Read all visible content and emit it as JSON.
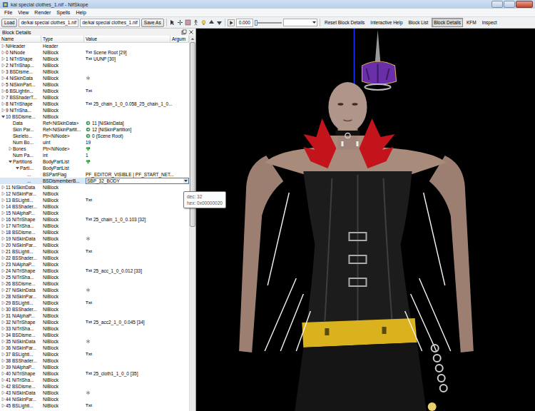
{
  "window": {
    "title": "kai special clothes_1.nif - NifSkope"
  },
  "menu": [
    "File",
    "View",
    "Render",
    "Spells",
    "Help"
  ],
  "toolbar": {
    "load": "Load",
    "paths": [
      "de/kai special clothes_1.nif",
      "de/kai special clothes_1.nif"
    ],
    "save_as": "Save As",
    "time": "0.000",
    "timeline_level": 0,
    "view_buttons": [
      {
        "label": "Reset Block Details",
        "selected": false
      },
      {
        "label": "Interactive Help",
        "selected": false
      },
      {
        "label": "Block List",
        "selected": false
      },
      {
        "label": "Block Details",
        "selected": true
      },
      {
        "label": "KFM",
        "selected": false
      },
      {
        "label": "Inspect",
        "selected": false
      }
    ]
  },
  "panel": {
    "title": "Block Details",
    "columns": [
      "Name",
      "Type",
      "Value",
      "Argum"
    ],
    "scrollbar_level": 0.5
  },
  "rows": [
    {
      "name": "NiHeader",
      "type": "Header",
      "tag": "",
      "value": "",
      "icon": "none",
      "depth": 0,
      "expandable": true,
      "expanded": false,
      "selected": false,
      "kind": "row"
    },
    {
      "name": "0 NiNode",
      "type": "NiBlock",
      "tag": "Txt",
      "value": "Scene Root [29]",
      "icon": "none",
      "depth": 0,
      "expandable": true,
      "expanded": false,
      "selected": false,
      "kind": "row"
    },
    {
      "name": "1 NiTriShape",
      "type": "NiBlock",
      "tag": "Txt",
      "value": "UUNP [30]",
      "icon": "none",
      "depth": 0,
      "expandable": true,
      "expanded": false,
      "selected": false,
      "kind": "row"
    },
    {
      "name": "2 NiTriShap...",
      "type": "NiBlock",
      "tag": "",
      "value": "",
      "icon": "none",
      "depth": 0,
      "expandable": true,
      "expanded": false,
      "selected": false,
      "kind": "row"
    },
    {
      "name": "3 BSDisme...",
      "type": "NiBlock",
      "tag": "",
      "value": "",
      "icon": "none",
      "depth": 0,
      "expandable": true,
      "expanded": false,
      "selected": false,
      "kind": "row"
    },
    {
      "name": "4 NiSkinData",
      "type": "NiBlock",
      "tag": "",
      "value": "",
      "icon": "skin",
      "depth": 0,
      "expandable": true,
      "expanded": false,
      "selected": false,
      "kind": "row"
    },
    {
      "name": "5 NiSkinPart...",
      "type": "NiBlock",
      "tag": "",
      "value": "",
      "icon": "none",
      "depth": 0,
      "expandable": true,
      "expanded": false,
      "selected": false,
      "kind": "row"
    },
    {
      "name": "6 BSLightin...",
      "type": "NiBlock",
      "tag": "Txt",
      "value": "",
      "icon": "none",
      "depth": 0,
      "expandable": true,
      "expanded": false,
      "selected": false,
      "kind": "row"
    },
    {
      "name": "7 BSShaderT...",
      "type": "NiBlock",
      "tag": "",
      "value": "",
      "icon": "none",
      "depth": 0,
      "expandable": true,
      "expanded": false,
      "selected": false,
      "kind": "row"
    },
    {
      "name": "8 NiTriShape",
      "type": "NiBlock",
      "tag": "Txt",
      "value": "25_chain_1_0_0.058_25_chain_1_0...",
      "icon": "none",
      "depth": 0,
      "expandable": true,
      "expanded": false,
      "selected": false,
      "kind": "row"
    },
    {
      "name": "9 NiTriSha...",
      "type": "NiBlock",
      "tag": "",
      "value": "",
      "icon": "none",
      "depth": 0,
      "expandable": true,
      "expanded": false,
      "selected": false,
      "kind": "row"
    },
    {
      "name": "10 BSDisme...",
      "type": "NiBlock",
      "tag": "",
      "value": "",
      "icon": "none",
      "depth": 0,
      "expandable": true,
      "expanded": true,
      "selected": false,
      "kind": "row"
    },
    {
      "name": "Data",
      "type": "Ref<NiSkinData>",
      "tag": "",
      "value": "11 [NiSkinData]",
      "icon": "ref",
      "depth": 1,
      "expandable": false,
      "expanded": false,
      "selected": false,
      "kind": "row"
    },
    {
      "name": "Skin Par...",
      "type": "Ref<NiSkinPartit...",
      "tag": "",
      "value": "12 [NiSkinPartition]",
      "icon": "ref",
      "depth": 1,
      "expandable": false,
      "expanded": false,
      "selected": false,
      "kind": "row"
    },
    {
      "name": "Skeleto...",
      "type": "Ptr<NiNode>",
      "tag": "",
      "value": "0 (Scene Root)",
      "icon": "ref",
      "depth": 1,
      "expandable": false,
      "expanded": false,
      "selected": false,
      "kind": "row"
    },
    {
      "name": "Num Bo...",
      "type": "uint",
      "tag": "",
      "value": "19",
      "icon": "none",
      "depth": 1,
      "expandable": false,
      "expanded": false,
      "selected": false,
      "kind": "row"
    },
    {
      "name": "Bones",
      "type": "Ptr<NiNode>",
      "tag": "",
      "value": "",
      "icon": "list",
      "depth": 1,
      "expandable": true,
      "expanded": false,
      "selected": false,
      "kind": "row"
    },
    {
      "name": "Num Pa...",
      "type": "int",
      "tag": "",
      "value": "1",
      "icon": "none",
      "depth": 1,
      "expandable": false,
      "expanded": false,
      "selected": false,
      "kind": "row"
    },
    {
      "name": "Partitions",
      "type": "BodyPartList",
      "tag": "",
      "value": "",
      "icon": "list",
      "depth": 1,
      "expandable": true,
      "expanded": true,
      "selected": false,
      "kind": "row"
    },
    {
      "name": "Parti...",
      "type": "BodyPartList",
      "tag": "",
      "value": "",
      "icon": "none",
      "depth": 2,
      "expandable": true,
      "expanded": true,
      "selected": false,
      "kind": "row"
    },
    {
      "name": "...",
      "type": "BSPartFlag",
      "tag": "",
      "value": "PF_EDITOR_VISIBLE | PF_START_NET...",
      "icon": "none",
      "depth": 3,
      "expandable": false,
      "expanded": false,
      "selected": false,
      "kind": "row"
    },
    {
      "name": "...",
      "type": "BSDismemberB...",
      "tag": "",
      "value": "SBP_32_BODY",
      "icon": "none",
      "depth": 3,
      "expandable": false,
      "expanded": false,
      "selected": true,
      "kind": "combo"
    },
    {
      "name": "11 NiSkinData",
      "type": "NiBlock",
      "tag": "",
      "value": "",
      "icon": "none",
      "depth": 0,
      "expandable": true,
      "expanded": false,
      "selected": false,
      "kind": "row"
    },
    {
      "name": "12 NiSkinPar...",
      "type": "NiBlock",
      "tag": "",
      "value": "",
      "icon": "none",
      "depth": 0,
      "expandable": true,
      "expanded": false,
      "selected": false,
      "kind": "row"
    },
    {
      "name": "13 BSLighti...",
      "type": "NiBlock",
      "tag": "Txt",
      "value": "",
      "icon": "none",
      "depth": 0,
      "expandable": true,
      "expanded": false,
      "selected": false,
      "kind": "row"
    },
    {
      "name": "14 BSShader...",
      "type": "NiBlock",
      "tag": "",
      "value": "",
      "icon": "none",
      "depth": 0,
      "expandable": true,
      "expanded": false,
      "selected": false,
      "kind": "row"
    },
    {
      "name": "15 NiAlphaP...",
      "type": "NiBlock",
      "tag": "",
      "value": "",
      "icon": "none",
      "depth": 0,
      "expandable": true,
      "expanded": false,
      "selected": false,
      "kind": "row"
    },
    {
      "name": "16 NiTriShape",
      "type": "NiBlock",
      "tag": "Txt",
      "value": "25_chain_1_0_0.103 [32]",
      "icon": "none",
      "depth": 0,
      "expandable": true,
      "expanded": false,
      "selected": false,
      "kind": "row"
    },
    {
      "name": "17 NiTriSha...",
      "type": "NiBlock",
      "tag": "",
      "value": "",
      "icon": "none",
      "depth": 0,
      "expandable": true,
      "expanded": false,
      "selected": false,
      "kind": "row"
    },
    {
      "name": "18 BSDisme...",
      "type": "NiBlock",
      "tag": "",
      "value": "",
      "icon": "none",
      "depth": 0,
      "expandable": true,
      "expanded": false,
      "selected": false,
      "kind": "row"
    },
    {
      "name": "19 NiSkinData",
      "type": "NiBlock",
      "tag": "",
      "value": "",
      "icon": "skin",
      "depth": 0,
      "expandable": true,
      "expanded": false,
      "selected": false,
      "kind": "row"
    },
    {
      "name": "20 NiSkinPar...",
      "type": "NiBlock",
      "tag": "",
      "value": "",
      "icon": "none",
      "depth": 0,
      "expandable": true,
      "expanded": false,
      "selected": false,
      "kind": "row"
    },
    {
      "name": "21 BSLighti...",
      "type": "NiBlock",
      "tag": "Txt",
      "value": "",
      "icon": "none",
      "depth": 0,
      "expandable": true,
      "expanded": false,
      "selected": false,
      "kind": "row"
    },
    {
      "name": "22 BSShader...",
      "type": "NiBlock",
      "tag": "",
      "value": "",
      "icon": "none",
      "depth": 0,
      "expandable": true,
      "expanded": false,
      "selected": false,
      "kind": "row"
    },
    {
      "name": "23 NiAlphaP...",
      "type": "NiBlock",
      "tag": "",
      "value": "",
      "icon": "none",
      "depth": 0,
      "expandable": true,
      "expanded": false,
      "selected": false,
      "kind": "row"
    },
    {
      "name": "24 NiTriShape",
      "type": "NiBlock",
      "tag": "Txt",
      "value": "25_acc_1_0_0.012 [33]",
      "icon": "none",
      "depth": 0,
      "expandable": true,
      "expanded": false,
      "selected": false,
      "kind": "row"
    },
    {
      "name": "25 NiTriSha...",
      "type": "NiBlock",
      "tag": "",
      "value": "",
      "icon": "none",
      "depth": 0,
      "expandable": true,
      "expanded": false,
      "selected": false,
      "kind": "row"
    },
    {
      "name": "26 BSDisme...",
      "type": "NiBlock",
      "tag": "",
      "value": "",
      "icon": "none",
      "depth": 0,
      "expandable": true,
      "expanded": false,
      "selected": false,
      "kind": "row"
    },
    {
      "name": "27 NiSkinData",
      "type": "NiBlock",
      "tag": "",
      "value": "",
      "icon": "skin",
      "depth": 0,
      "expandable": true,
      "expanded": false,
      "selected": false,
      "kind": "row"
    },
    {
      "name": "28 NiSkinPar...",
      "type": "NiBlock",
      "tag": "",
      "value": "",
      "icon": "none",
      "depth": 0,
      "expandable": true,
      "expanded": false,
      "selected": false,
      "kind": "row"
    },
    {
      "name": "29 BSLighti...",
      "type": "NiBlock",
      "tag": "Txt",
      "value": "",
      "icon": "none",
      "depth": 0,
      "expandable": true,
      "expanded": false,
      "selected": false,
      "kind": "row"
    },
    {
      "name": "30 BSShader...",
      "type": "NiBlock",
      "tag": "",
      "value": "",
      "icon": "none",
      "depth": 0,
      "expandable": true,
      "expanded": false,
      "selected": false,
      "kind": "row"
    },
    {
      "name": "31 NiAlphaP...",
      "type": "NiBlock",
      "tag": "",
      "value": "",
      "icon": "none",
      "depth": 0,
      "expandable": true,
      "expanded": false,
      "selected": false,
      "kind": "row"
    },
    {
      "name": "32 NiTriShape",
      "type": "NiBlock",
      "tag": "Txt",
      "value": "25_acc2_1_0_0.045 [34]",
      "icon": "none",
      "depth": 0,
      "expandable": true,
      "expanded": false,
      "selected": false,
      "kind": "row"
    },
    {
      "name": "33 NiTriSha...",
      "type": "NiBlock",
      "tag": "",
      "value": "",
      "icon": "none",
      "depth": 0,
      "expandable": true,
      "expanded": false,
      "selected": false,
      "kind": "row"
    },
    {
      "name": "34 BSDisme...",
      "type": "NiBlock",
      "tag": "",
      "value": "",
      "icon": "none",
      "depth": 0,
      "expandable": true,
      "expanded": false,
      "selected": false,
      "kind": "row"
    },
    {
      "name": "35 NiSkinData",
      "type": "NiBlock",
      "tag": "",
      "value": "",
      "icon": "skin",
      "depth": 0,
      "expandable": true,
      "expanded": false,
      "selected": false,
      "kind": "row"
    },
    {
      "name": "36 NiSkinPar...",
      "type": "NiBlock",
      "tag": "",
      "value": "",
      "icon": "none",
      "depth": 0,
      "expandable": true,
      "expanded": false,
      "selected": false,
      "kind": "row"
    },
    {
      "name": "37 BSLighti...",
      "type": "NiBlock",
      "tag": "Txt",
      "value": "",
      "icon": "none",
      "depth": 0,
      "expandable": true,
      "expanded": false,
      "selected": false,
      "kind": "row"
    },
    {
      "name": "38 BSShader...",
      "type": "NiBlock",
      "tag": "",
      "value": "",
      "icon": "none",
      "depth": 0,
      "expandable": true,
      "expanded": false,
      "selected": false,
      "kind": "row"
    },
    {
      "name": "39 NiAlphaP...",
      "type": "NiBlock",
      "tag": "",
      "value": "",
      "icon": "none",
      "depth": 0,
      "expandable": true,
      "expanded": false,
      "selected": false,
      "kind": "row"
    },
    {
      "name": "40 NiTriShape",
      "type": "NiBlock",
      "tag": "Txt",
      "value": "25_cloth1_1_0_0 [35]",
      "icon": "none",
      "depth": 0,
      "expandable": true,
      "expanded": false,
      "selected": false,
      "kind": "row"
    },
    {
      "name": "41 NiTriSha...",
      "type": "NiBlock",
      "tag": "",
      "value": "",
      "icon": "none",
      "depth": 0,
      "expandable": true,
      "expanded": false,
      "selected": false,
      "kind": "row"
    },
    {
      "name": "42 BSDisme...",
      "type": "NiBlock",
      "tag": "",
      "value": "",
      "icon": "none",
      "depth": 0,
      "expandable": true,
      "expanded": false,
      "selected": false,
      "kind": "row"
    },
    {
      "name": "43 NiSkinData",
      "type": "NiBlock",
      "tag": "",
      "value": "",
      "icon": "skin",
      "depth": 0,
      "expandable": true,
      "expanded": false,
      "selected": false,
      "kind": "row"
    },
    {
      "name": "44 NiSkinPar...",
      "type": "NiBlock",
      "tag": "",
      "value": "",
      "icon": "none",
      "depth": 0,
      "expandable": true,
      "expanded": false,
      "selected": false,
      "kind": "row"
    },
    {
      "name": "45 BSLighti...",
      "type": "NiBlock",
      "tag": "Txt",
      "value": "",
      "icon": "none",
      "depth": 0,
      "expandable": true,
      "expanded": false,
      "selected": false,
      "kind": "row"
    }
  ],
  "tooltip": {
    "lines": [
      "dec: 32",
      "hex: 0x00000020"
    ]
  }
}
